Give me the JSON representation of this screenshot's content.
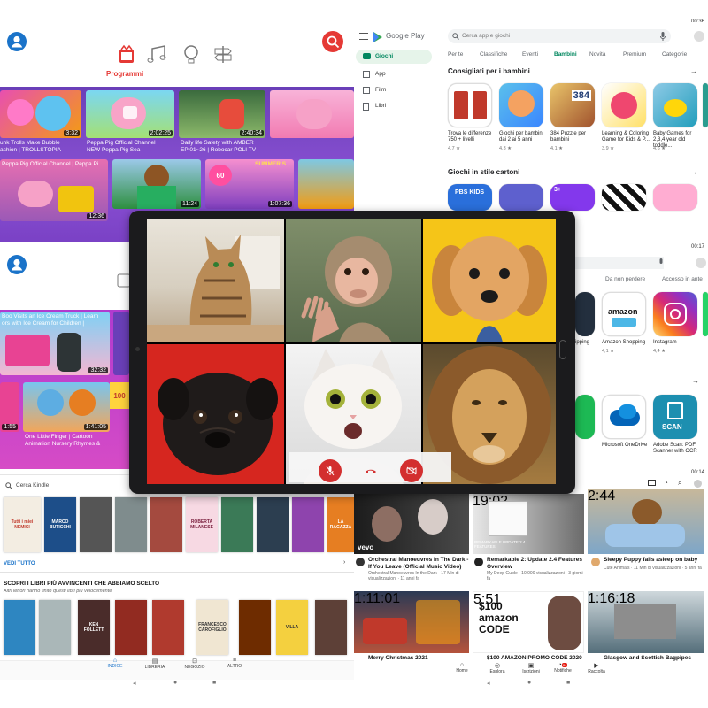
{
  "yt_kids": {
    "section_label": "Programmi",
    "videos_top": [
      {
        "title": "unk Trolls Make Bubble",
        "subtitle": "ashion | TROLLSTOPIA",
        "duration": "3:32",
        "channel_tag": "unk Kids"
      },
      {
        "title": "Peppa Pig Official Channel",
        "subtitle": "NEW Peppa Pig Sea",
        "duration": "2:02:25"
      },
      {
        "title": "Daily life Safety with AMBER",
        "subtitle": "EP 01~26 | Robocar POLI TV",
        "duration": "2:40:34"
      },
      {
        "title": "Peppa Pig Official Channel | Pep",
        "subtitle": "",
        "duration": ""
      }
    ],
    "videos_row2": [
      {
        "title": "Peppa Pig Official Channel | Peppa Pigs",
        "duration": "12:36"
      },
      {
        "title": "",
        "duration": "11:24"
      },
      {
        "title": "SUMMER SPECIAL",
        "duration": "1:07:36"
      },
      {
        "title": "",
        "duration": ""
      }
    ],
    "videos_lower": [
      {
        "title": "Boo Visits an Ice Cream Truck | Learn",
        "subtitle": "ors with Ice Cream for Children |",
        "duration": "32:32"
      },
      {
        "title": "One Little Finger | Cartoon Animation Nursery Rhymes &",
        "duration": "1:41:05"
      },
      {
        "title": "",
        "duration": "1:55"
      }
    ],
    "sticker_text": "100"
  },
  "play_store": {
    "logo_text": "Google Play",
    "search_placeholder": "Cerca app e giochi",
    "sidebar": [
      {
        "label": "Giochi",
        "icon": "gamepad-icon",
        "active": true
      },
      {
        "label": "App",
        "icon": "grid-icon"
      },
      {
        "label": "Film",
        "icon": "film-icon"
      },
      {
        "label": "Libri",
        "icon": "book-icon"
      }
    ],
    "tabs": [
      "Per te",
      "Classifiche",
      "Eventi",
      "Bambini",
      "Novità",
      "Premium",
      "Categorie"
    ],
    "active_tab": "Bambini",
    "section1": "Consigliati per i bambini",
    "apps1": [
      {
        "name": "Trova le differenze 750 + livelli",
        "rating": "4,7 ★"
      },
      {
        "name": "Giochi per bambini dai 2 ai 5 anni",
        "rating": "4,3 ★"
      },
      {
        "name": "384 Puzzle per bambini",
        "rating": "4,1 ★"
      },
      {
        "name": "Learning & Coloring Game for Kids & P...",
        "rating": "3,9 ★"
      },
      {
        "name": "Baby Games for 2,3,4 year old toddle...",
        "rating": "4,6 ★"
      },
      {
        "name": "Gi ba",
        "rating": "4,"
      }
    ],
    "section2": "Giochi in stile cartoni",
    "tabs2": [
      "Da non perdere",
      "Accesso in ante"
    ],
    "apps2": [
      {
        "name": "ipping",
        "rating": ""
      },
      {
        "name": "Amazon Shopping",
        "rating": "4,1 ★"
      },
      {
        "name": "Instagram",
        "rating": "4,4 ★"
      }
    ],
    "apps3": [
      {
        "name": "Microsoft OneDrive",
        "rating": ""
      },
      {
        "name": "Adobe Scan: PDF Scanner with OCR",
        "rating": ""
      }
    ],
    "time1": "00:36",
    "time2": "00:17",
    "time3": "00:14",
    "amazon_label": "amazon",
    "scan_label": "SCAN",
    "pbs_label": "PBS KIDS",
    "badge_384": "384",
    "badge_3plus": "3+"
  },
  "kindle": {
    "search_placeholder": "Cerca Kindle",
    "see_all": "VEDI TUTTO",
    "section_title": "SCOPRI I LIBRI PIÙ AVVINCENTI CHE ABBIAMO SCELTO",
    "section_sub": "Altri lettori hanno finito questi libri più velocemente",
    "books_row1": [
      "Tutti i miei NEMICI",
      "MARCO BUTICCHI",
      "",
      "",
      "",
      "ROBERTA MILANESE",
      "",
      "",
      "LA RAGAZZA"
    ],
    "books_row2": [
      "",
      "",
      "KEN FOLLETT",
      "",
      "",
      "FRANCESCO CAROFIGLIO",
      "",
      "VILLA",
      ""
    ],
    "nav": [
      "INDICE",
      "LIBRERIA",
      "NEGOZIO",
      "ALTRO"
    ]
  },
  "youtube": {
    "videos": [
      {
        "title": "Orchestral Manoeuvres In The Dark - If You Leave (Official Music Video)",
        "meta": "Orchestral Manoeuvres In the Dark · 17 Mln di visualizzazioni · 11 anni fa",
        "duration": "",
        "tag": "vevo"
      },
      {
        "title": "Remarkable 2: Update 2.4 Features Overview",
        "meta": "My Deep Guide · 10.000 visualizzazioni · 3 giorni fa",
        "duration": "19:02",
        "tag": "REMARKABLE UPDATE 2.4 FEATURES"
      },
      {
        "title": "Sleepy Puppy falls asleep on baby",
        "meta": "Cute Animals · 11 Mln di visualizzazioni · 5 anni fa",
        "duration": "2:44"
      },
      {
        "title": "Merry Christmas 2021",
        "meta": "",
        "duration": "1:11:01"
      },
      {
        "title": "$100 AMAZON PROMO CODE 2020",
        "meta": "",
        "duration": "5:51",
        "tag": "$100 amazon CODE"
      },
      {
        "title": "Glasgow and Scottish Bagpipes",
        "meta": "",
        "duration": "1:16:18"
      }
    ],
    "nav": [
      "Home",
      "Esplora",
      "Iscrizioni",
      "Notifiche",
      "Raccolta"
    ],
    "notif_badge": "9+"
  },
  "tablet_call": {
    "participants": [
      "cat-tabby",
      "monkey",
      "puppy-poodle",
      "pug",
      "kitten-white",
      "lion"
    ]
  },
  "colors": {
    "yt_red": "#e62117",
    "kids_purple": "#7b44c8",
    "play_green": "#01875f"
  }
}
